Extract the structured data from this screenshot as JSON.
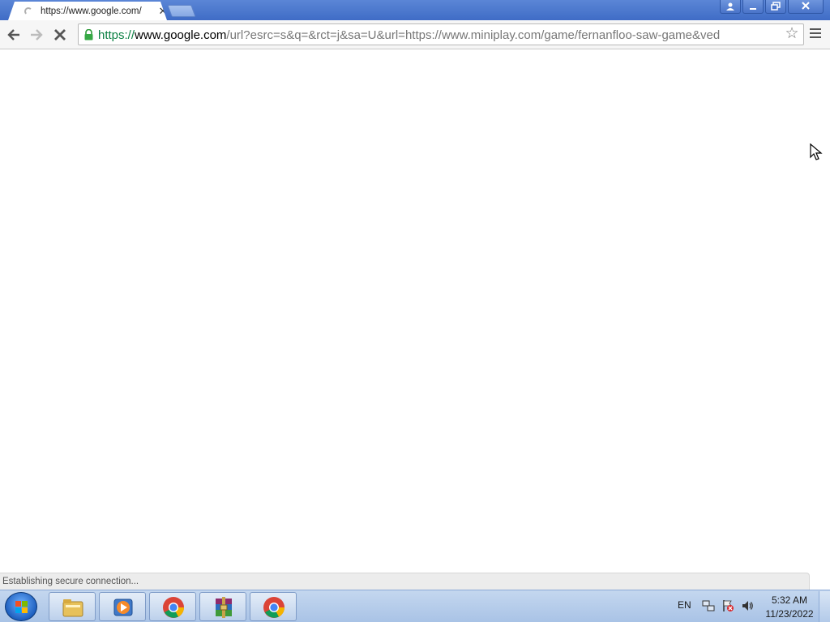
{
  "browser": {
    "tab": {
      "title": "https://www.google.com/",
      "close_glyph": "✕"
    },
    "window_controls": {
      "user": "👤",
      "minimize": "—",
      "restore": "❐",
      "close": "✕"
    },
    "toolbar": {
      "back_glyph": "←",
      "forward_glyph": "→",
      "stop_glyph": "✕",
      "url_scheme": "https://",
      "url_host": "www.google.com",
      "url_rest": "/url?esrc=s&q=&rct=j&sa=U&url=https://www.miniplay.com/game/fernanfloo-saw-game&ved",
      "star_glyph": "☆"
    },
    "status_text": "Establishing secure connection..."
  },
  "taskbar": {
    "apps": [
      {
        "name": "file-explorer-icon"
      },
      {
        "name": "media-player-icon"
      },
      {
        "name": "chrome-icon"
      },
      {
        "name": "winrar-icon"
      },
      {
        "name": "chrome-icon"
      }
    ],
    "tray": {
      "language": "EN"
    },
    "clock": {
      "time": "5:32 AM",
      "date": "11/23/2022"
    }
  },
  "colors": {
    "titlebar": "#4a78cf",
    "url_scheme_green": "#0b8043",
    "taskbar": "#b7cdea"
  }
}
